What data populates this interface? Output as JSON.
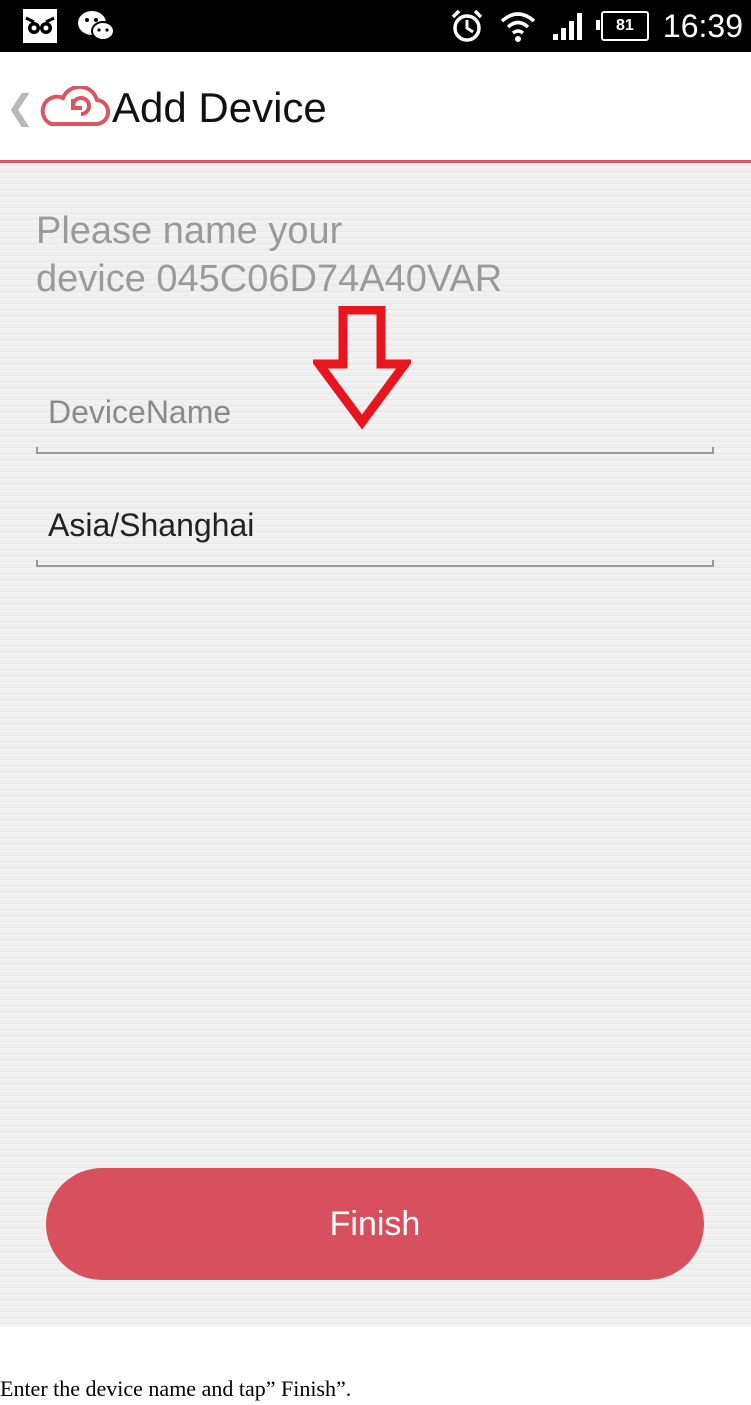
{
  "status_bar": {
    "time": "16:39",
    "battery": "81",
    "left_icons": [
      "calendar-cat-icon",
      "wechat-icon"
    ],
    "right_icons": [
      "alarm-icon",
      "wifi-icon",
      "signal-icon",
      "battery-icon"
    ]
  },
  "header": {
    "back_icon": "chevron-left-icon",
    "logo_icon": "cloud-logo-icon",
    "title": "Add Device"
  },
  "main": {
    "instruction_line1": "Please name your",
    "instruction_line2": "device 045C06D74A40VAR",
    "device_name_field": {
      "placeholder": "DeviceName",
      "value": ""
    },
    "timezone_field": {
      "value": "Asia/Shanghai"
    },
    "finish_label": "Finish"
  },
  "annotation_arrow": "down-arrow-icon",
  "caption": "Enter the device name and tap” Finish”.",
  "colors": {
    "accent": "#d8505e",
    "header_border": "#d85662",
    "arrow": "#e8141e",
    "background": "#ededed"
  }
}
